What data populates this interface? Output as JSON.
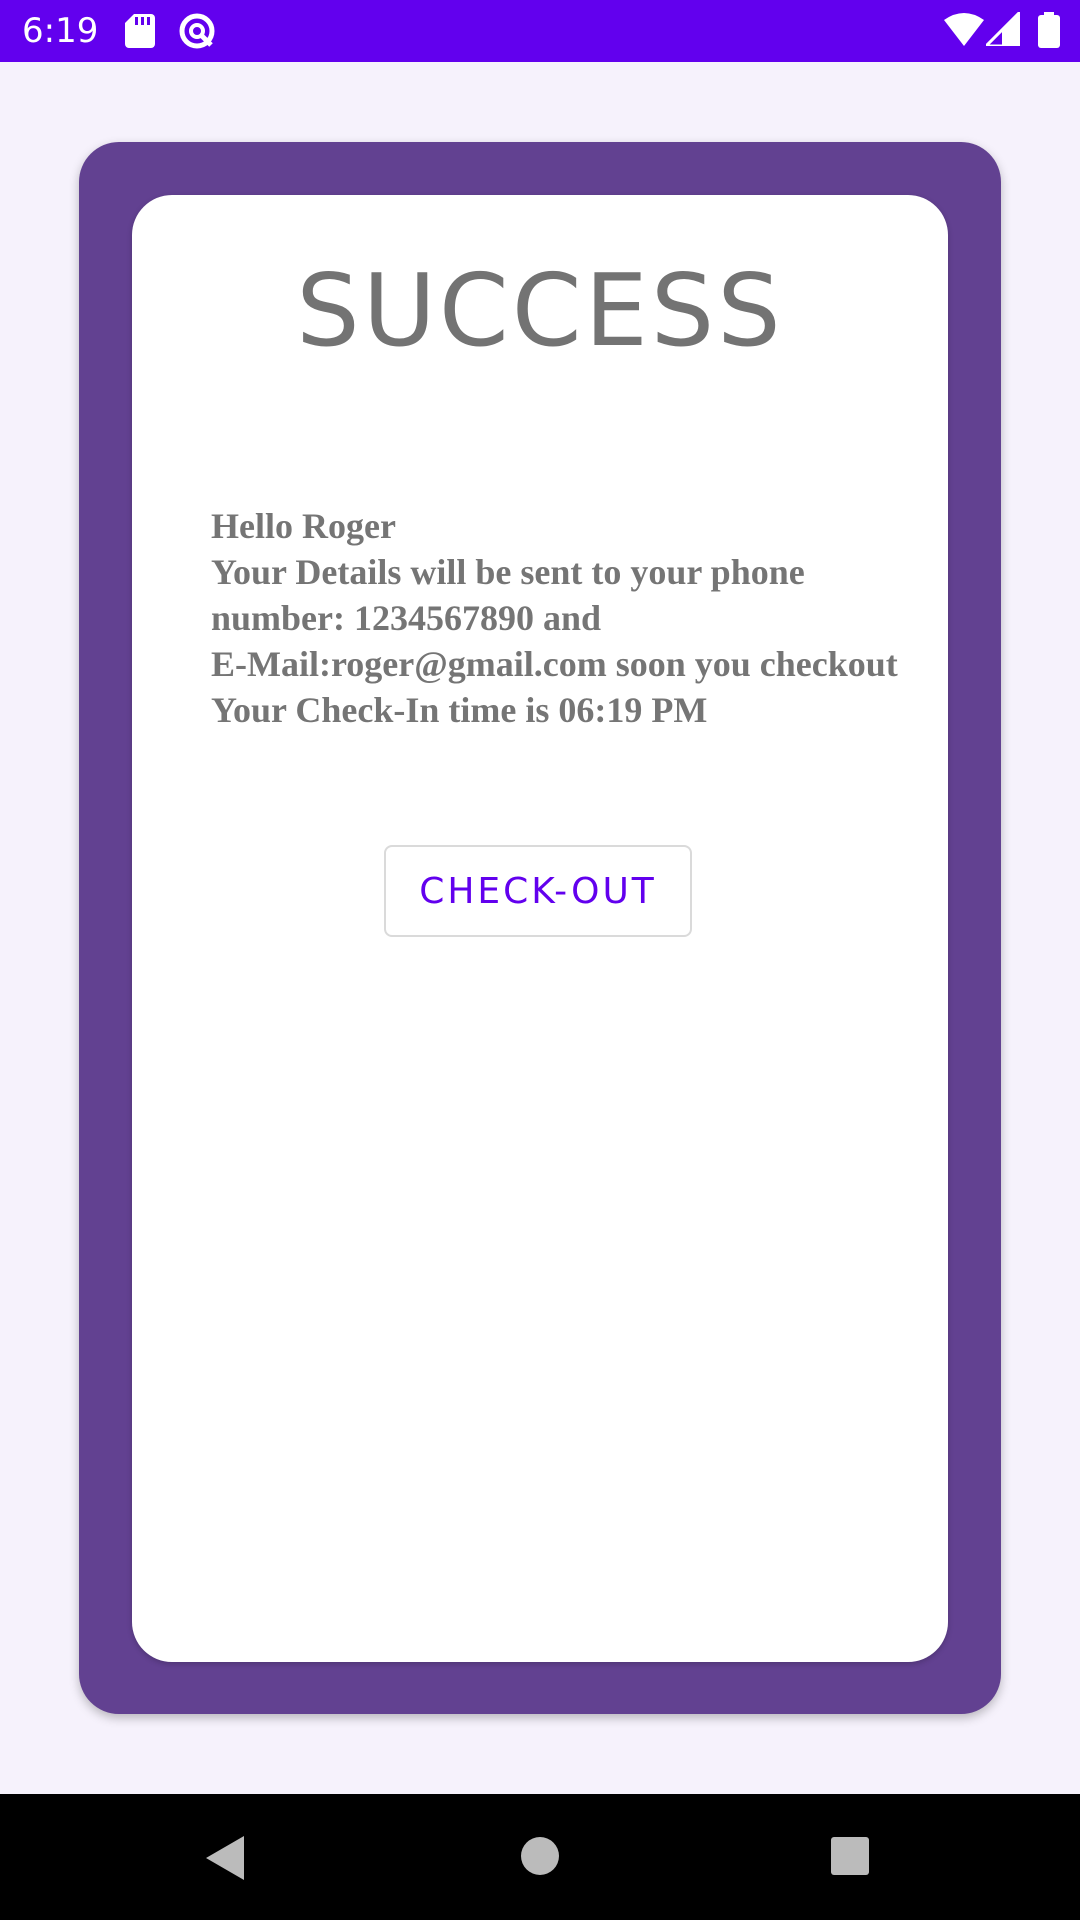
{
  "status_bar": {
    "time": "6:19",
    "icons": [
      "sd-card-icon",
      "sync-icon",
      "wifi-icon",
      "signal-icon",
      "battery-icon"
    ],
    "background_color": "#6200EE"
  },
  "card": {
    "title": "SUCCESS",
    "message_lines": [
      "Hello Roger",
      "Your Details will be sent to your phone",
      "number: 1234567890 and",
      "E-Mail:roger@gmail.com soon you checkout",
      "Your Check-In time is 06:19 PM"
    ],
    "checkout_button_label": "CHECK-OUT",
    "outer_color": "#624191",
    "accent_color": "#6200EE"
  },
  "nav_bar": {
    "buttons": [
      "back-icon",
      "home-icon",
      "recents-icon"
    ]
  }
}
